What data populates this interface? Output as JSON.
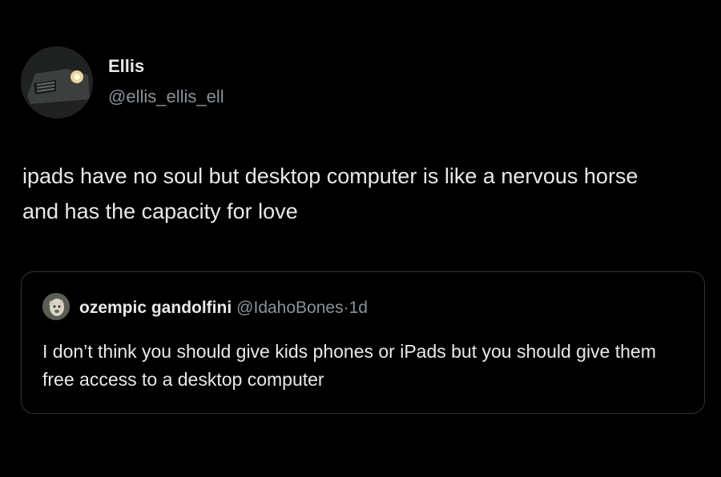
{
  "tweet": {
    "author_name": "Ellis",
    "author_handle": "@ellis_ellis_ell",
    "avatar_icon": "car-headlight-avatar-icon",
    "text": "ipads have no soul but desktop computer is like a nervous horse and has the capacity for love"
  },
  "quote": {
    "author_name": "ozempic gandolfini",
    "author_handle": "@IdahoBones",
    "separator": "·",
    "time": "1d",
    "avatar_icon": "animal-avatar-icon",
    "text": "I don’t think you should give kids phones or iPads but you should give them free access to a desktop computer"
  },
  "colors": {
    "background": "#000000",
    "primary_text": "#e7e9ea",
    "secondary_text": "#8b9199",
    "border": "#2f3336"
  }
}
